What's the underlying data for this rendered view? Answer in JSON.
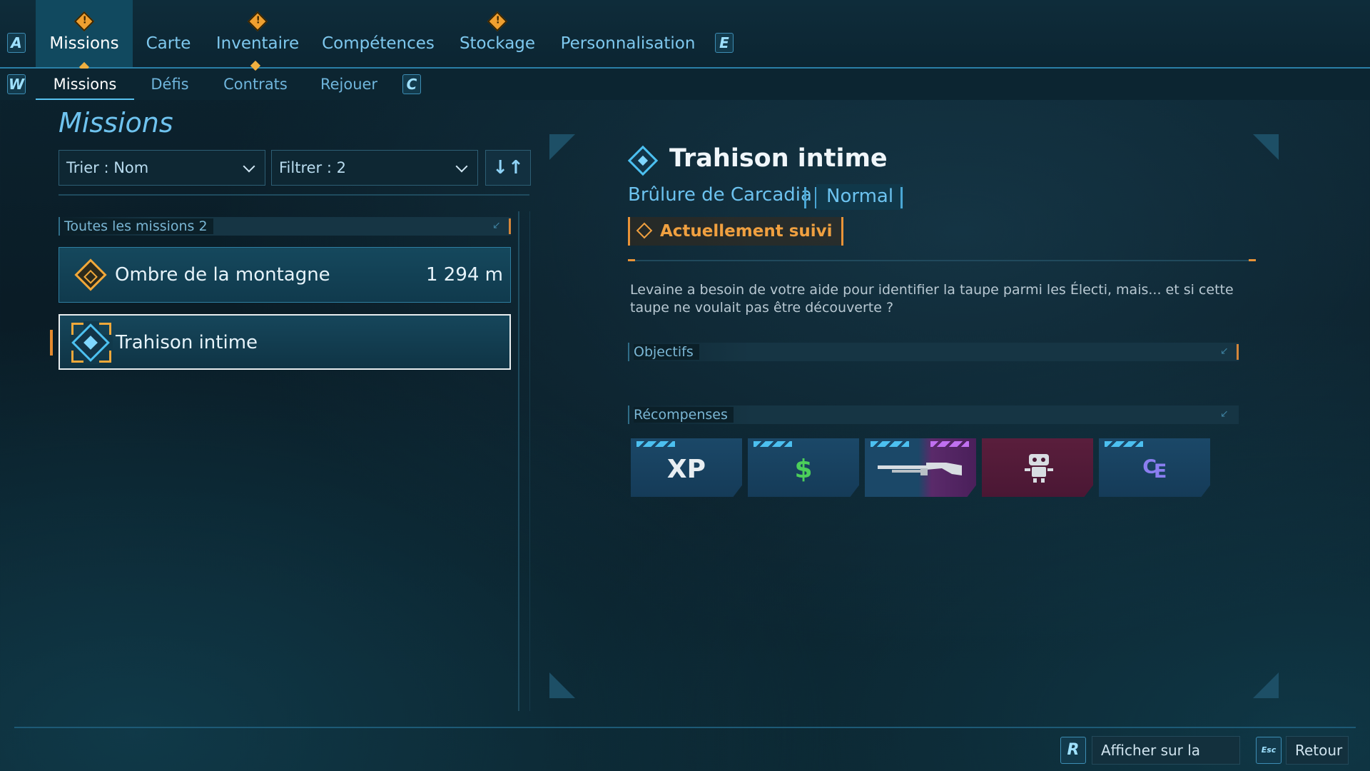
{
  "nav": {
    "left_key": "A",
    "right_key": "E",
    "tabs": [
      {
        "label": "Missions",
        "active": true,
        "warning": true
      },
      {
        "label": "Carte",
        "active": false,
        "warning": false
      },
      {
        "label": "Inventaire",
        "active": false,
        "warning": true
      },
      {
        "label": "Compétences",
        "active": false,
        "warning": false
      },
      {
        "label": "Stockage",
        "active": false,
        "warning": true
      },
      {
        "label": "Personnalisation",
        "active": false,
        "warning": false
      }
    ]
  },
  "subnav": {
    "left_key": "W",
    "right_key": "C",
    "tabs": [
      {
        "label": "Missions",
        "active": true
      },
      {
        "label": "Défis",
        "active": false
      },
      {
        "label": "Contrats",
        "active": false
      },
      {
        "label": "Rejouer",
        "active": false
      }
    ]
  },
  "left": {
    "title": "Missions",
    "sort_label": "Trier : Nom",
    "filter_label": "Filtrer : 2",
    "sort_toggle": "↓↑",
    "section_label": "Toutes les missions 2",
    "missions": [
      {
        "name": "Ombre de la montagne",
        "distance": "1 294 m",
        "icon": "gold-diamond-icon",
        "selected": false
      },
      {
        "name": "Trahison intime",
        "distance": "",
        "icon": "blue-diamond-icon",
        "selected": true
      }
    ]
  },
  "detail": {
    "title": "Trahison intime",
    "region": "Brûlure de Carcadia",
    "difficulty": "Normal",
    "tracked_label": "Actuellement suivi",
    "description": "Levaine a besoin de votre aide pour identifier la taupe parmi les Électi, mais... et si cette taupe ne voulait pas être découverte ?",
    "objectives_label": "Objectifs",
    "rewards_label": "Récompenses",
    "rewards": [
      {
        "icon": "xp-icon",
        "glyph": "XP",
        "color": "#e8eef2"
      },
      {
        "icon": "cash-icon",
        "glyph": "$",
        "color": "#4ccf5a"
      },
      {
        "icon": "shotgun-icon",
        "glyph": "",
        "color": "#d8dde2"
      },
      {
        "icon": "robot-customization-icon",
        "glyph": "",
        "color": "#d8dde2"
      },
      {
        "icon": "eridium-icon",
        "glyph": "₠",
        "color": "#8a7ef0"
      }
    ]
  },
  "footer": {
    "map_key": "R",
    "map_label": "Afficher sur la carte",
    "back_key": "Esc",
    "back_label": "Retour"
  },
  "colors": {
    "accent_blue": "#4cc0f0",
    "accent_orange": "#e89338",
    "active_tab_bg": "#11495f"
  }
}
